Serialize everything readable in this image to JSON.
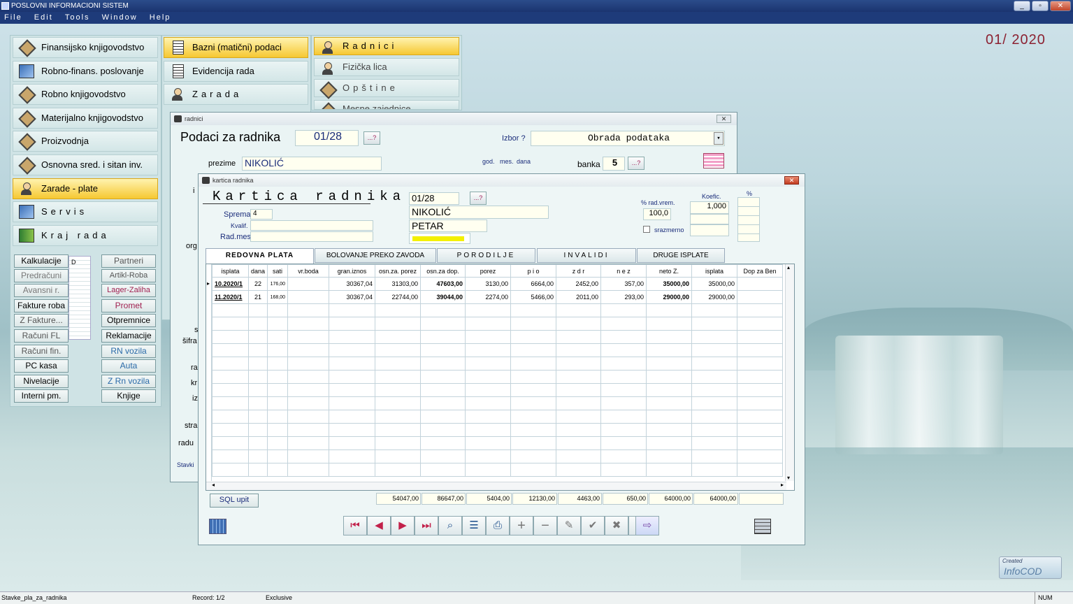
{
  "app": {
    "title": "POSLOVNI INFORMACIONI SISTEM",
    "menu": [
      "File",
      "Edit",
      "Tools",
      "Window",
      "Help"
    ],
    "period": "01/ 2020"
  },
  "col1": [
    {
      "label": "Finansijsko knjigovodstvo",
      "icon": "ledger-icon"
    },
    {
      "label": "Robno-finans. poslovanje",
      "icon": "chart-icon"
    },
    {
      "label": "Robno knjigovodstvo",
      "icon": "ledger-icon"
    },
    {
      "label": "Materijalno knjigovodstvo",
      "icon": "ledger-icon"
    },
    {
      "label": "Proizvodnja",
      "icon": "ledger-icon"
    },
    {
      "label": "Osnovna sred. i sitan inv.",
      "icon": "ledger-icon"
    },
    {
      "label": "Zarade - plate",
      "icon": "money-icon"
    },
    {
      "label": "Servis",
      "icon": "computer-icon"
    },
    {
      "label": "Kraj rada",
      "icon": "exit-door-icon"
    }
  ],
  "col2": [
    "Bazni (matični) podaci",
    "Evidencija rada",
    "Zarada"
  ],
  "col3": [
    "Radnici",
    "Fizička lica",
    "Opštine",
    "Mesne zajednice"
  ],
  "small_left": [
    "Kalkulacije",
    "Predračuni",
    "Avansni r.",
    "Fakture roba",
    "Z Fakture...",
    "Računi FL",
    "Računi fin.",
    "PC kasa",
    "Nivelacije",
    "Interni pm."
  ],
  "small_right": [
    "Partneri",
    "Artikl-Roba",
    "Lager-Zaliha",
    "Promet",
    "Otpremnice",
    "Reklamacije",
    "RN vozila",
    "Auta",
    "Z Rn vozila",
    "Knjige"
  ],
  "behind_letter": "D",
  "radnici": {
    "window_title": "radnici",
    "heading": "Podaci za radnika",
    "id": "01/28",
    "qbtn": "...?",
    "izbor_label": "Izbor ?",
    "izbor_value": "Obrada podataka",
    "prezime_label": "prezime",
    "prezime": "NIKOLIĆ",
    "god_label": "god.",
    "mes_label": "mes.",
    "dana_label": "dana",
    "banka_label": "banka",
    "banka": "5",
    "side_labels": [
      "i",
      "org",
      "s",
      "šifra",
      "ra",
      "kr",
      "iz",
      "stra",
      "radu",
      "Stavki"
    ]
  },
  "kartica": {
    "window_title": "kartica radnika",
    "heading": "Kartica radnika",
    "id": "01/28",
    "qbtn": "...?",
    "sprema_label": "Sprema",
    "sprema": "4",
    "kvalif_label": "Kvalif.",
    "radmes_label": "Rad.mes",
    "last_name": "NIKOLIĆ",
    "first_name": "PETAR",
    "rad_vrem_label": "% rad.vrem.",
    "rad_vrem": "100,0",
    "koef_label": "Koefic.",
    "koef": "1,000",
    "pct_label": "%",
    "srazmerno_label": "srazmerno",
    "tabs": [
      "REDOVNA PLATA",
      "BOLOVANJE PREKO ZAVODA",
      "PORODILJE",
      "INVALIDI",
      "DRUGE ISPLATE"
    ],
    "columns": [
      "isplata",
      "dana",
      "sati",
      "vr.boda",
      "gran.iznos",
      "osn.za. porez",
      "osn.za dop.",
      "porez",
      "p i o",
      "z d r",
      "n e z",
      "neto Z.",
      "isplata",
      "Dop za Ben"
    ],
    "rows": [
      [
        "10.2020/1",
        "22",
        "176,00",
        "",
        "30367,04",
        "31303,00",
        "47603,00",
        "3130,00",
        "6664,00",
        "2452,00",
        "357,00",
        "35000,00",
        "35000,00",
        ""
      ],
      [
        "11.2020/1",
        "21",
        "168,00",
        "",
        "30367,04",
        "22744,00",
        "39044,00",
        "2274,00",
        "5466,00",
        "2011,00",
        "293,00",
        "29000,00",
        "29000,00",
        ""
      ]
    ],
    "totals": [
      "54047,00",
      "86647,00",
      "5404,00",
      "12130,00",
      "4463,00",
      "650,00",
      "64000,00",
      "64000,00",
      ""
    ],
    "sql_button": "SQL upit"
  },
  "status": {
    "left": "Stavke_pla_za_radnika",
    "record": "Record: 1/2",
    "mode": "Exclusive",
    "num": "NUM"
  },
  "watermark": {
    "line1": "Created",
    "line2": "InfoCOD"
  }
}
